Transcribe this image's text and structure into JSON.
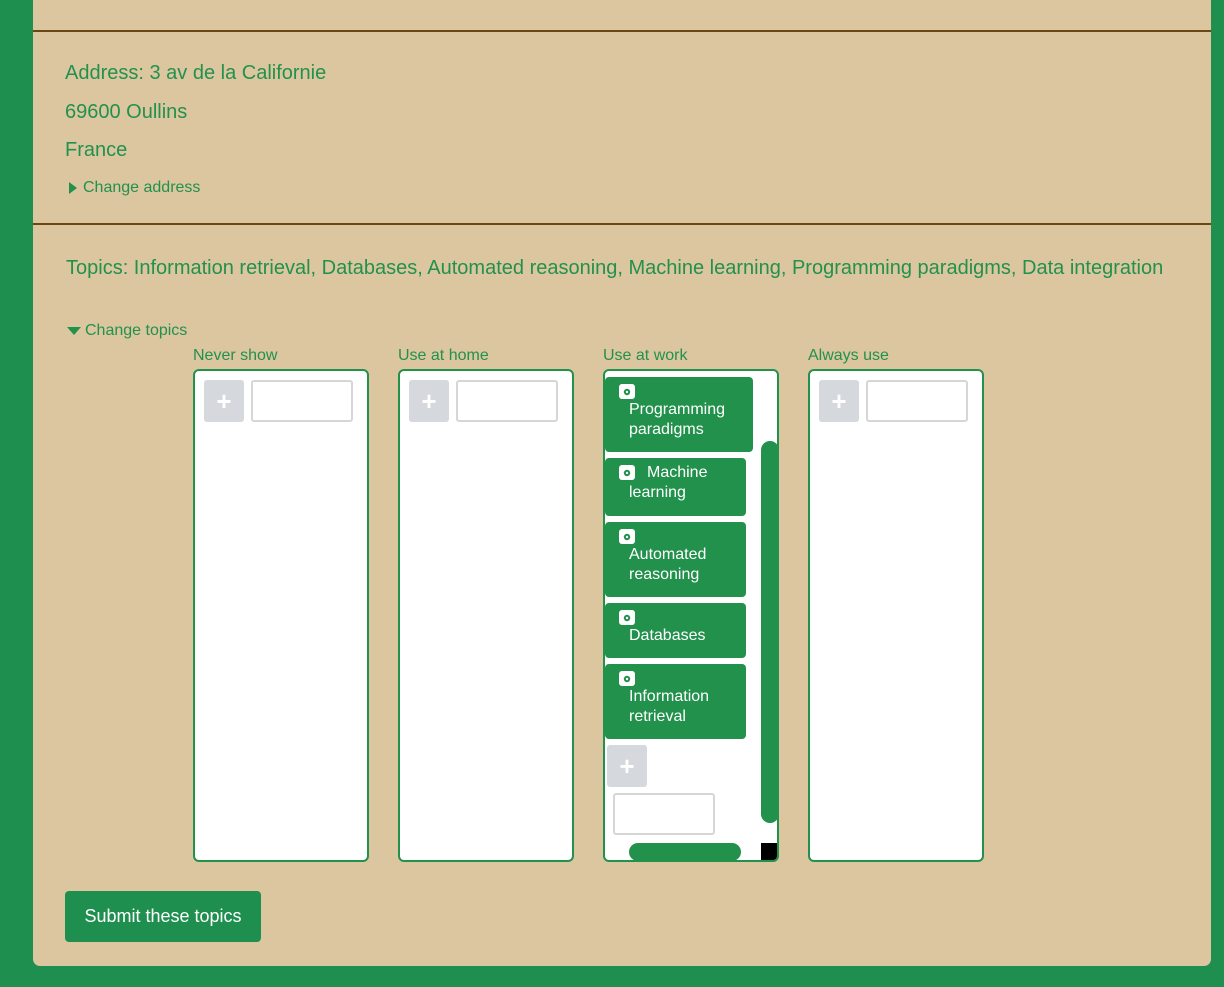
{
  "address": {
    "line1": "Address: 3 av de la Californie",
    "line2": "69600 Oullins",
    "line3": "France",
    "change_label": "Change address"
  },
  "topics": {
    "summary": "Topics: Information retrieval, Databases, Automated reasoning, Machine learning, Programming paradigms, Data integration",
    "change_label": "Change topics",
    "columns": [
      {
        "title": "Never show",
        "items": []
      },
      {
        "title": "Use at home",
        "items": []
      },
      {
        "title": "Use at work",
        "items": [
          "Programming paradigms",
          "Machine learning",
          "Automated reasoning",
          "Databases",
          "Information retrieval"
        ]
      },
      {
        "title": "Always use",
        "items": []
      }
    ],
    "add_symbol": "+",
    "submit_label": "Submit these topics"
  },
  "colors": {
    "frame_green": "#1e8f4e",
    "text_green": "#22914c",
    "panel_beige": "#dcc6a0",
    "rule_brown": "#6b4714"
  },
  "icons": {
    "chip_icon": "gear-icon",
    "address_toggle": "triangle-right-icon",
    "topics_toggle": "triangle-down-icon"
  }
}
